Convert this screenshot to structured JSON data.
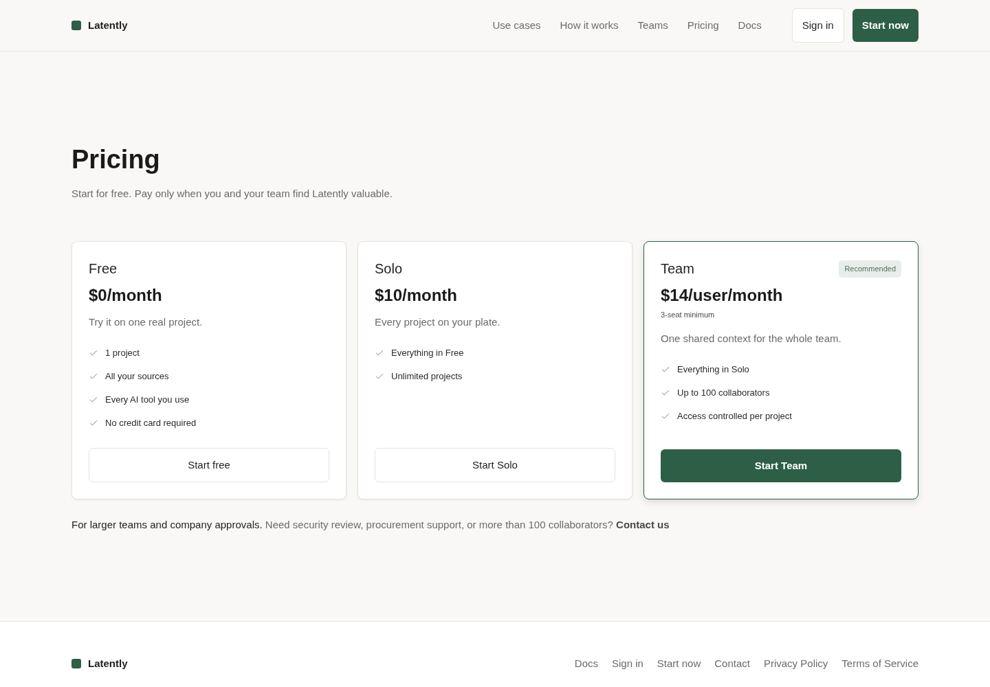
{
  "header": {
    "brand": "Latently",
    "nav": [
      "Use cases",
      "How it works",
      "Teams",
      "Pricing",
      "Docs"
    ],
    "sign_in": "Sign in",
    "start_now": "Start now"
  },
  "hero": {
    "title": "Pricing",
    "subtitle": "Start for free. Pay only when you and your team find Latently valuable."
  },
  "plans": [
    {
      "name": "Free",
      "price": "$0/month",
      "description": "Try it on one real project.",
      "features": [
        "1 project",
        "All your sources",
        "Every AI tool you use",
        "No credit card required"
      ],
      "cta": "Start free",
      "featured": false
    },
    {
      "name": "Solo",
      "price": "$10/month",
      "description": "Every project on your plate.",
      "features": [
        "Everything in Free",
        "Unlimited projects"
      ],
      "cta": "Start Solo",
      "featured": false
    },
    {
      "name": "Team",
      "badge": "Recommended",
      "price": "$14/user/month",
      "note": "3-seat minimum",
      "description": "One shared context for the whole team.",
      "features": [
        "Everything in Solo",
        "Up to 100 collaborators",
        "Access controlled per project"
      ],
      "cta": "Start Team",
      "featured": true
    }
  ],
  "enterprise_note": {
    "lead": "For larger teams and company approvals.",
    "text": "Need security review, procurement support, or more than 100 collaborators?",
    "link": "Contact us"
  },
  "footer": {
    "brand": "Latently",
    "links": [
      "Docs",
      "Sign in",
      "Start now",
      "Contact",
      "Privacy Policy",
      "Terms of Service"
    ]
  }
}
